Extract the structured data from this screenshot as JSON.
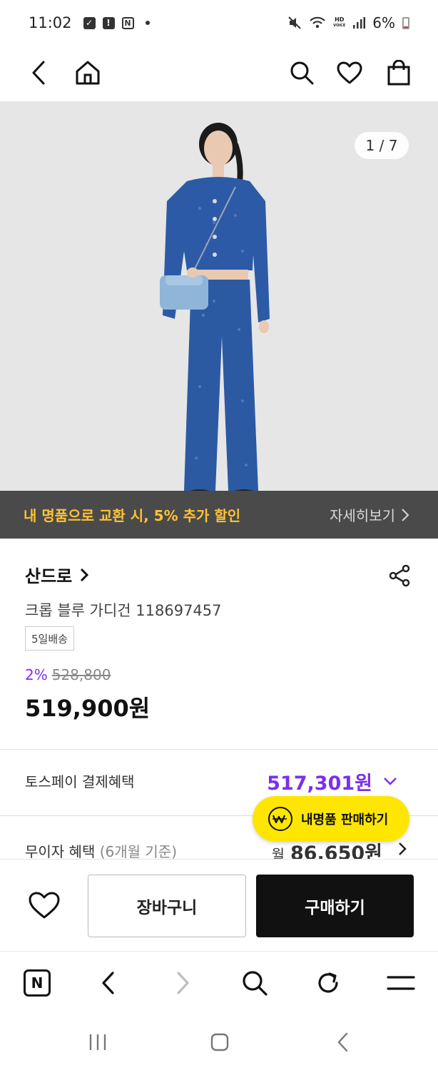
{
  "status_bar": {
    "time": "11:02",
    "battery": "6%",
    "hd_line1": "HD",
    "hd_line2": "VOICE",
    "icons": [
      "check-box-icon",
      "alert-icon",
      "nfc-icon",
      "dot-icon",
      "mute-icon",
      "wifi-icon",
      "signal-icon",
      "battery-icon"
    ]
  },
  "top_nav": {
    "icons": [
      "back-arrow-icon",
      "home-icon",
      "search-icon",
      "heart-icon",
      "shopping-bag-icon"
    ]
  },
  "hero": {
    "image_counter": "1 / 7",
    "banner_text": "내 명품으로 교환 시, 5% 추가 할인",
    "banner_more": "자세히보기",
    "colors": {
      "banner_bg": "#4a4a4a",
      "banner_text": "#ffc233",
      "bg": "#e6e6e6",
      "jacket": "#2c5aa6",
      "bag": "#8fb6d9"
    }
  },
  "product": {
    "brand": "산드로",
    "name": "크롭 블루 가디건 118697457",
    "shipping_badge": "5일배송",
    "discount_rate": "2%",
    "original_price": "528,800",
    "price": "519,900원"
  },
  "benefits": {
    "toss_label": "토스페이 결제혜택",
    "toss_price": "517,301원",
    "interest_label": "무이자 혜택",
    "interest_sub": "(6개월 기준)",
    "interest_prefix": "월",
    "interest_amount": "86,650원"
  },
  "fab": {
    "label": "내명품 판매하기",
    "color": "#ffe600"
  },
  "actions": {
    "cart_label": "장바구니",
    "buy_label": "구매하기"
  },
  "browser_bar": {
    "items": [
      "naver-n-icon",
      "back-icon",
      "forward-icon",
      "search-icon",
      "refresh-icon",
      "menu-icon"
    ],
    "n_letter": "N"
  },
  "system_nav": {
    "items": [
      "recent-apps-icon",
      "home-icon",
      "back-icon"
    ]
  },
  "colors": {
    "accent_purple": "#7b2ff0",
    "primary_black": "#111111"
  }
}
